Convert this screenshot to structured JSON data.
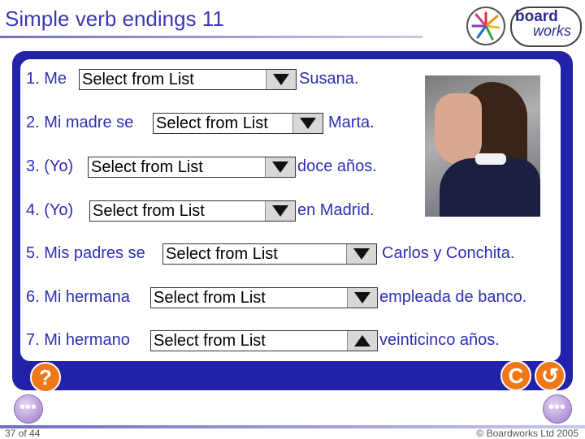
{
  "header": {
    "title": "Simple verb endings 11"
  },
  "logo": {
    "line1": "board",
    "line2": "works"
  },
  "select_placeholder": "Select from List",
  "questions": [
    {
      "prefix": "1. Me",
      "suffix": "Susana.",
      "arrow": "down"
    },
    {
      "prefix": "2. Mi madre se",
      "suffix": "Marta.",
      "arrow": "down"
    },
    {
      "prefix": "3. (Yo)",
      "suffix": "doce años.",
      "arrow": "down"
    },
    {
      "prefix": "4. (Yo)",
      "suffix": "en Madrid.",
      "arrow": "down"
    },
    {
      "prefix": "5. Mis padres se",
      "suffix": "Carlos y Conchita.",
      "arrow": "down"
    },
    {
      "prefix": "6. Mi hermana",
      "suffix": "empleada de banco.",
      "arrow": "down"
    },
    {
      "prefix": "7. Mi hermano",
      "suffix": "veinticinco años.",
      "arrow": "up"
    }
  ],
  "controls": {
    "help": "?",
    "clear": "C",
    "undo": "↺"
  },
  "footer": {
    "page": "37 of 44",
    "copyright": "© Boardworks Ltd 2005"
  },
  "colors": {
    "accent": "#2222a8",
    "text": "#2e2eb4",
    "button": "#f07818"
  }
}
